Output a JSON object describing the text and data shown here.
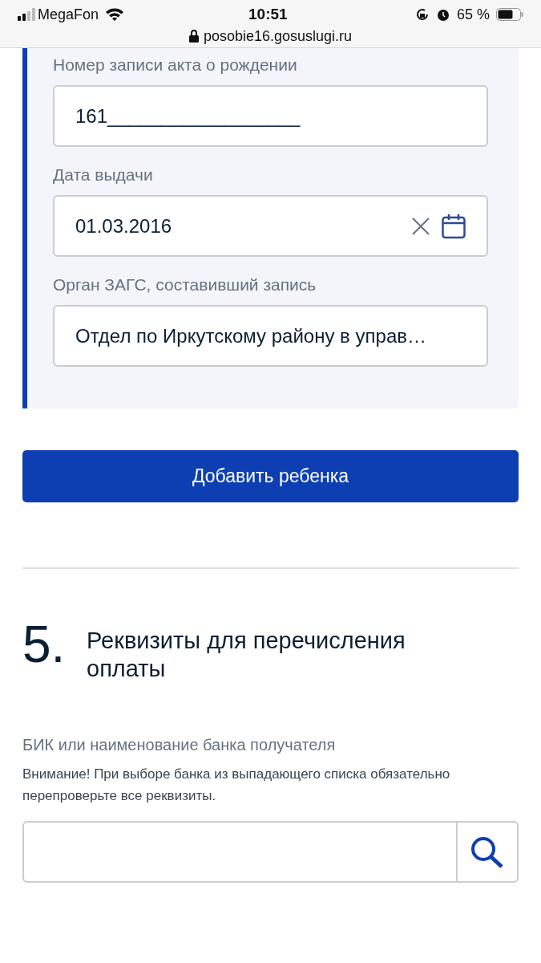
{
  "status_bar": {
    "carrier": "MegaFon",
    "time": "10:51",
    "battery": "65 %",
    "url": "posobie16.gosuslugi.ru"
  },
  "child_card": {
    "fields": [
      {
        "label": "Номер записи акта о рождении",
        "value": "161__________________",
        "kind": "text"
      },
      {
        "label": "Дата выдачи",
        "value": "01.03.2016",
        "kind": "date"
      },
      {
        "label": "Орган ЗАГС, составивший запись",
        "value": "Отдел по Иркутскому району в управ…",
        "kind": "text"
      }
    ]
  },
  "add_button": "Добавить ребенка",
  "section": {
    "number": "5.",
    "title": "Реквизиты для перечисления оплаты",
    "field_label": "БИК или наименование банка получателя",
    "note": "Внимание! При выборе банка из выпадающего списка обязательно перепроверьте все реквизиты."
  }
}
